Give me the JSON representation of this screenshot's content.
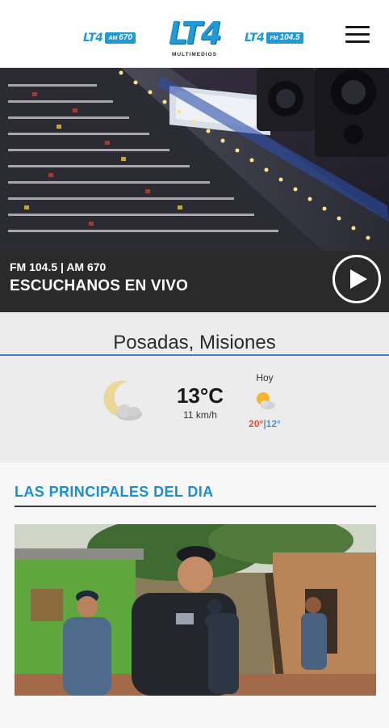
{
  "header": {
    "logo_text": "LT4",
    "logo_subtitle": "MULTIMEDIOS",
    "badge_am": {
      "brand": "LT4",
      "band": "AM",
      "freq": "670"
    },
    "badge_fm": {
      "brand": "LT4",
      "band": "FM",
      "freq": "104.5"
    },
    "menu_icon": "hamburger-menu-icon"
  },
  "live": {
    "frequencies": "FM 104.5 | AM 670",
    "title": "ESCUCHANOS EN VIVO",
    "play_icon": "play-icon"
  },
  "weather": {
    "city": "Posadas, Misiones",
    "current_icon": "moon-cloud-icon",
    "temperature": "13°C",
    "wind": "11 km/h",
    "today_label": "Hoy",
    "today_icon": "sun-cloud-icon",
    "today_max": "20°",
    "separator": "|",
    "today_min": "12°"
  },
  "section": {
    "title": "LAS PRINCIPALES DEL DIA"
  },
  "colors": {
    "brand_blue": "#1f9ad6",
    "live_bar": "#2a2a2a",
    "section_title": "#1a8fd2",
    "max_temp": "#d9533c",
    "min_temp": "#5b8ed6"
  }
}
